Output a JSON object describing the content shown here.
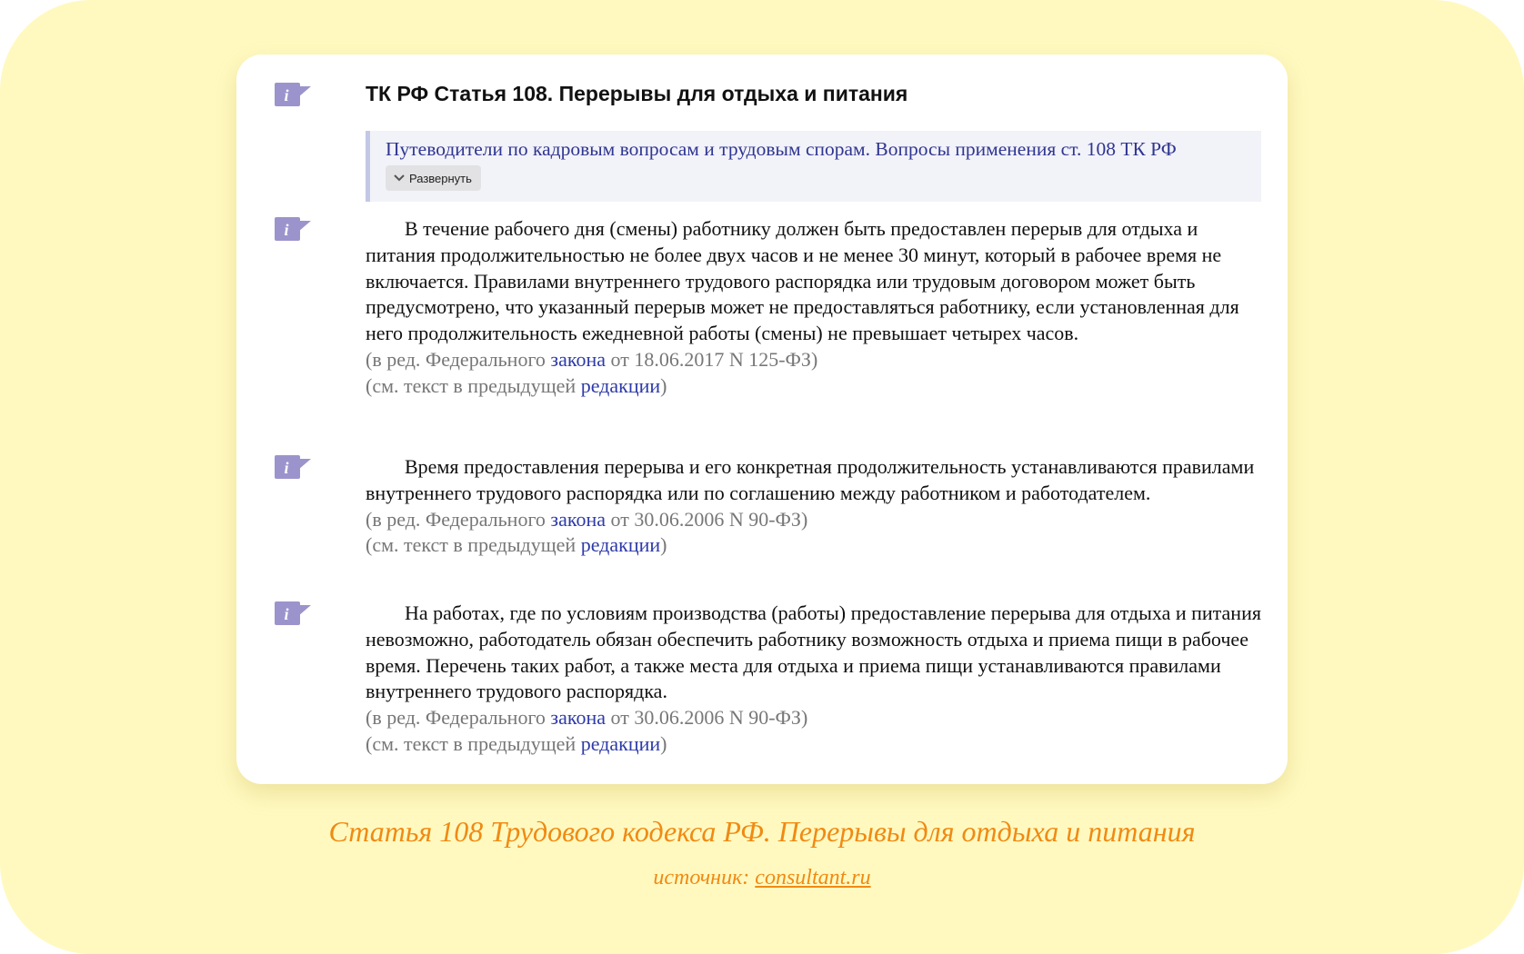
{
  "article": {
    "title": "ТК РФ Статья 108. Перерывы для отдыха и питания",
    "guide_link": "Путеводители по кадровым вопросам и трудовым спорам. Вопросы применения ст. 108 ТК РФ",
    "expand_label": "Развернуть",
    "paragraphs": [
      {
        "text": "В течение рабочего дня (смены) работнику должен быть предоставлен перерыв для отдыха и питания продолжительностью не более двух часов и не менее 30 минут, который в рабочее время не включается. Правилами внутреннего трудового распорядка или трудовым договором может быть предусмотрено, что указанный перерыв может не предоставляться работнику, если установленная для него продолжительность ежедневной работы (смены) не превышает четырех часов.",
        "edit_prefix": "(в ред. Федерального ",
        "edit_link": "закона",
        "edit_suffix": " от 18.06.2017 N 125-ФЗ)",
        "prev_prefix": "(см. текст в предыдущей ",
        "prev_link": "редакции",
        "prev_suffix": ")"
      },
      {
        "text": "Время предоставления перерыва и его конкретная продолжительность устанавливаются правилами внутреннего трудового распорядка или по соглашению между работником и работодателем.",
        "edit_prefix": "(в ред. Федерального ",
        "edit_link": "закона",
        "edit_suffix": " от 30.06.2006 N 90-ФЗ)",
        "prev_prefix": "(см. текст в предыдущей ",
        "prev_link": "редакции",
        "prev_suffix": ")"
      },
      {
        "text": "На работах, где по условиям производства (работы) предоставление перерыва для отдыха и питания невозможно, работодатель обязан обеспечить работнику возможность отдыха и приема пищи в рабочее время. Перечень таких работ, а также места для отдыха и приема пищи устанавливаются правилами внутреннего трудового распорядка.",
        "edit_prefix": "(в ред. Федерального ",
        "edit_link": "закона",
        "edit_suffix": " от 30.06.2006 N 90-ФЗ)",
        "prev_prefix": "(см. текст в предыдущей ",
        "prev_link": "редакции",
        "prev_suffix": ")"
      }
    ]
  },
  "caption": {
    "title": "Статья 108 Трудового кодекса РФ. Перерывы для отдыха и питания",
    "source_label": "источник: ",
    "source_link": "consultant.ru"
  },
  "icons": {
    "info": "info-icon",
    "expand": "chevron-down-icon"
  },
  "colors": {
    "background": "#fff9c0",
    "card": "#ffffff",
    "info_icon": "#9b94cc",
    "link": "#2d3aa8",
    "guide_link": "#2f3690",
    "note": "#777777",
    "caption": "#f08a13"
  }
}
